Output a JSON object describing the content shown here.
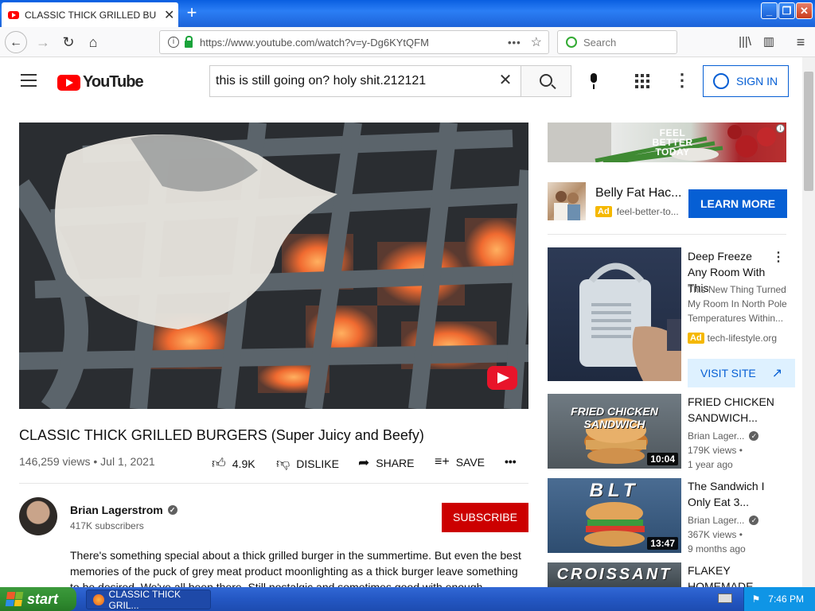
{
  "browser": {
    "tab_title": "CLASSIC THICK GRILLED BURGERS",
    "tab_close": "✕",
    "new_tab": "+",
    "url": "https://www.youtube.com/watch?v=y-Dg6KYtQFM",
    "url_menu": "•••",
    "search_placeholder": "Search",
    "window_buttons": [
      "_",
      "❐",
      "✕"
    ]
  },
  "youtube": {
    "logo_text": "YouTube",
    "search_value": "this is still going on? holy shit.212121",
    "sign_in": "SIGN IN"
  },
  "video": {
    "title": "CLASSIC THICK GRILLED BURGERS (Super Juicy and Beefy)",
    "views_date": "146,259 views • Jul 1, 2021",
    "likes": "4.9K",
    "dislike": "DISLIKE",
    "share": "SHARE",
    "save": "SAVE",
    "more": "•••",
    "channel_name": "Brian Lagerstrom",
    "subscribers": "417K subscribers",
    "subscribe": "SUBSCRIBE",
    "description": "There's something special about a thick grilled burger in the summertime. But even the best memories of the puck of grey meat product moonlighting as a thick burger leave something to be desired. We've all been there. Still nostalgic and sometimes good with enough toppings."
  },
  "sidebar": {
    "banner_text": "FEEL BETTER TODAY",
    "banner_info": "i",
    "ad1": {
      "title": "Belly Fat Hac...",
      "badge": "Ad",
      "source": "feel-better-to...",
      "button": "LEARN MORE"
    },
    "ad2": {
      "title": "Deep Freeze Any Room With This",
      "description": "This New Thing Turned My Room In North Pole Temperatures Within...",
      "badge": "Ad",
      "source": "tech-lifestyle.org",
      "button": "VISIT SITE"
    },
    "recs": [
      {
        "thumb_text": "FRIED CHICKEN SANDWICH",
        "title": "FRIED CHICKEN SANDWICH...",
        "channel": "Brian Lager...",
        "views": "179K views •",
        "age": "1 year ago",
        "duration": "10:04"
      },
      {
        "thumb_text": "BLT",
        "title": "The Sandwich I Only Eat 3...",
        "channel": "Brian Lager...",
        "views": "367K views •",
        "age": "9 months ago",
        "duration": "13:47"
      },
      {
        "thumb_text": "CROISSANT",
        "title": "FLAKEY HOMEMADE",
        "channel": "",
        "views": "",
        "age": "",
        "duration": ""
      }
    ]
  },
  "taskbar": {
    "start": "start",
    "task_label": "CLASSIC THICK GRIL...",
    "clock": "7:46 PM"
  },
  "colors": {
    "youtube_red": "#ff0000",
    "subscribe_red": "#cc0000",
    "link_blue": "#065fd4",
    "ad_yellow": "#f5b800",
    "xp_blue": "#2457c3"
  }
}
